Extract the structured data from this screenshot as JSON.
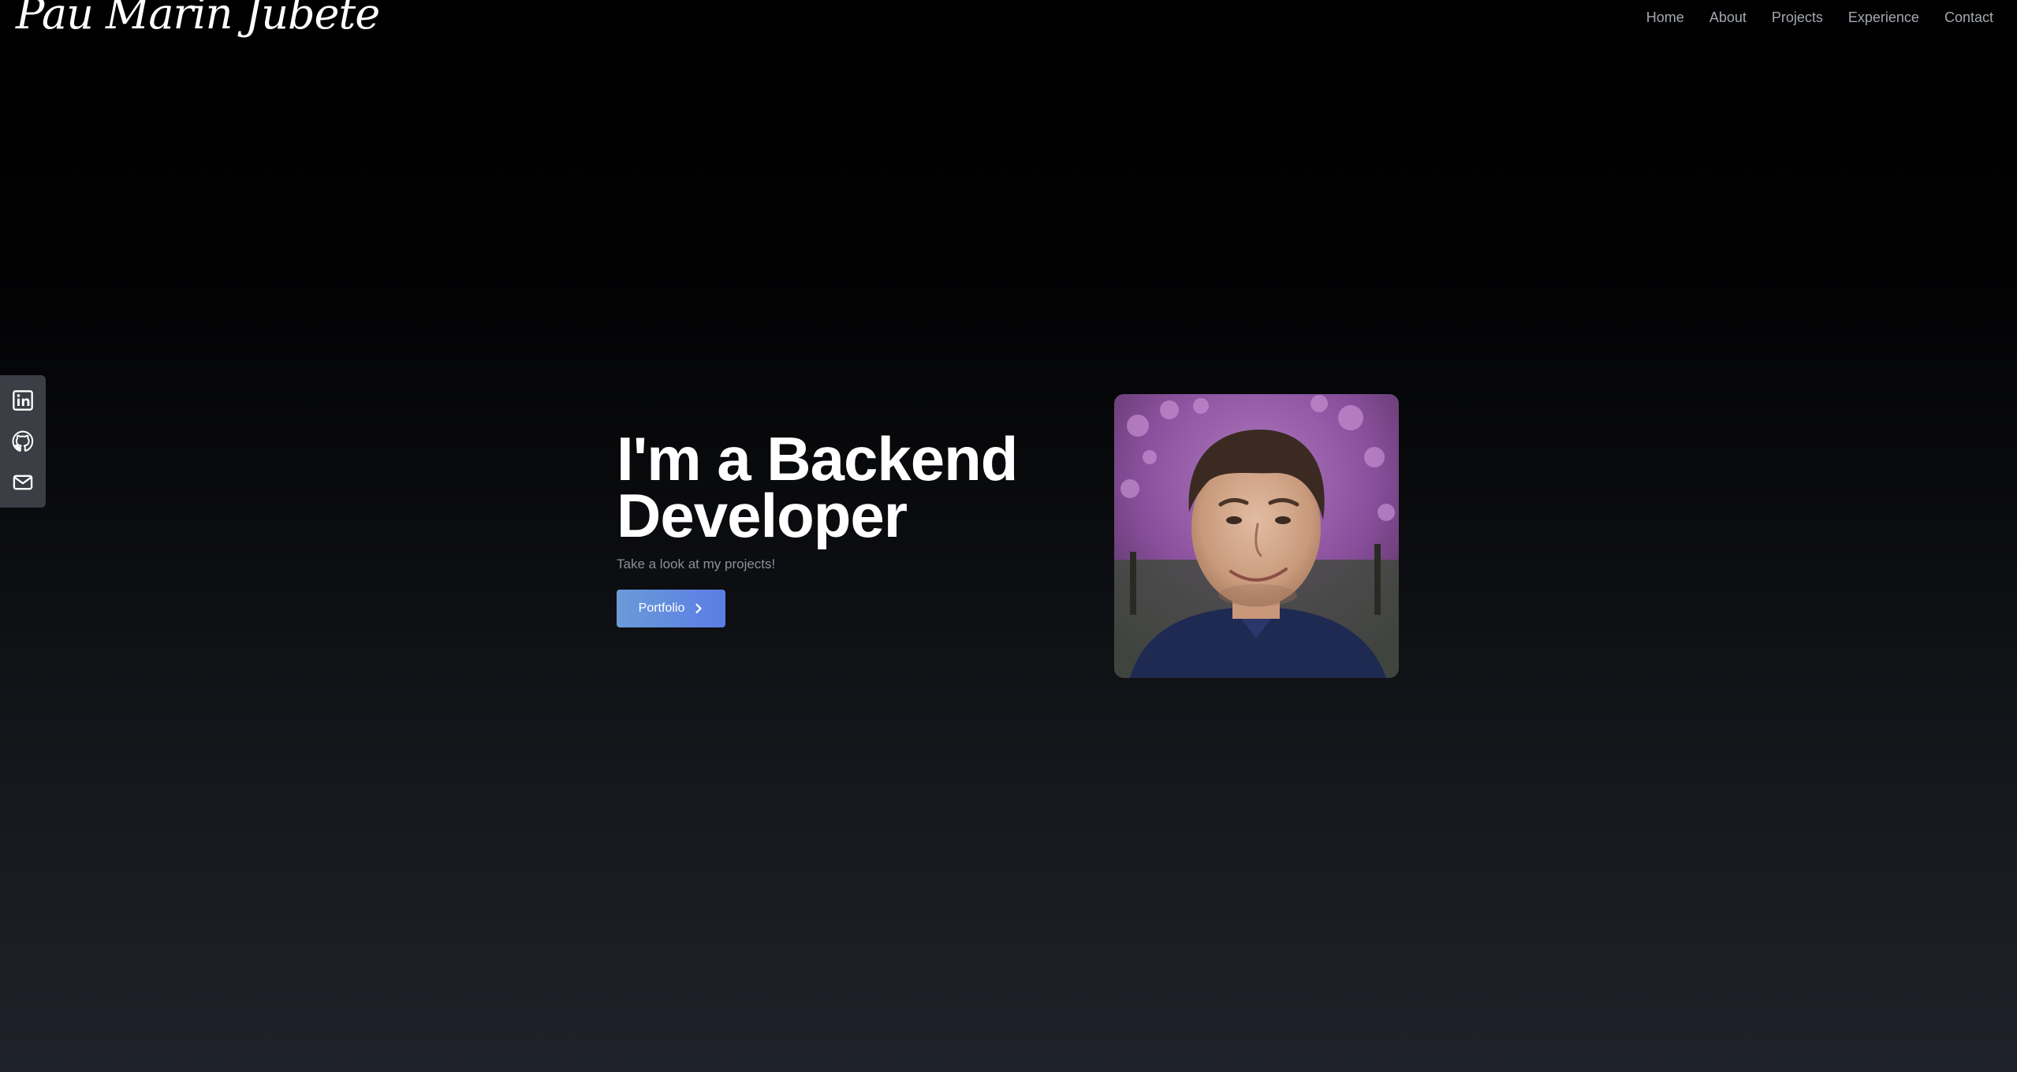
{
  "header": {
    "logo": "Pau Marin Jubete",
    "nav": [
      "Home",
      "About",
      "Projects",
      "Experience",
      "Contact"
    ]
  },
  "social": {
    "icons": [
      "linkedin-icon",
      "github-icon",
      "mail-icon"
    ]
  },
  "hero": {
    "title_line1": "I'm a Backend",
    "title_line2": "Developer",
    "subtitle": "Take a look at my projects!",
    "button_label": "Portfolio"
  },
  "colors": {
    "accent_start": "#6b9ad8",
    "accent_end": "#5a7de6",
    "nav_text": "#a3a7b0",
    "subtitle_text": "#8b909b",
    "social_bar": "#3b3e45"
  }
}
